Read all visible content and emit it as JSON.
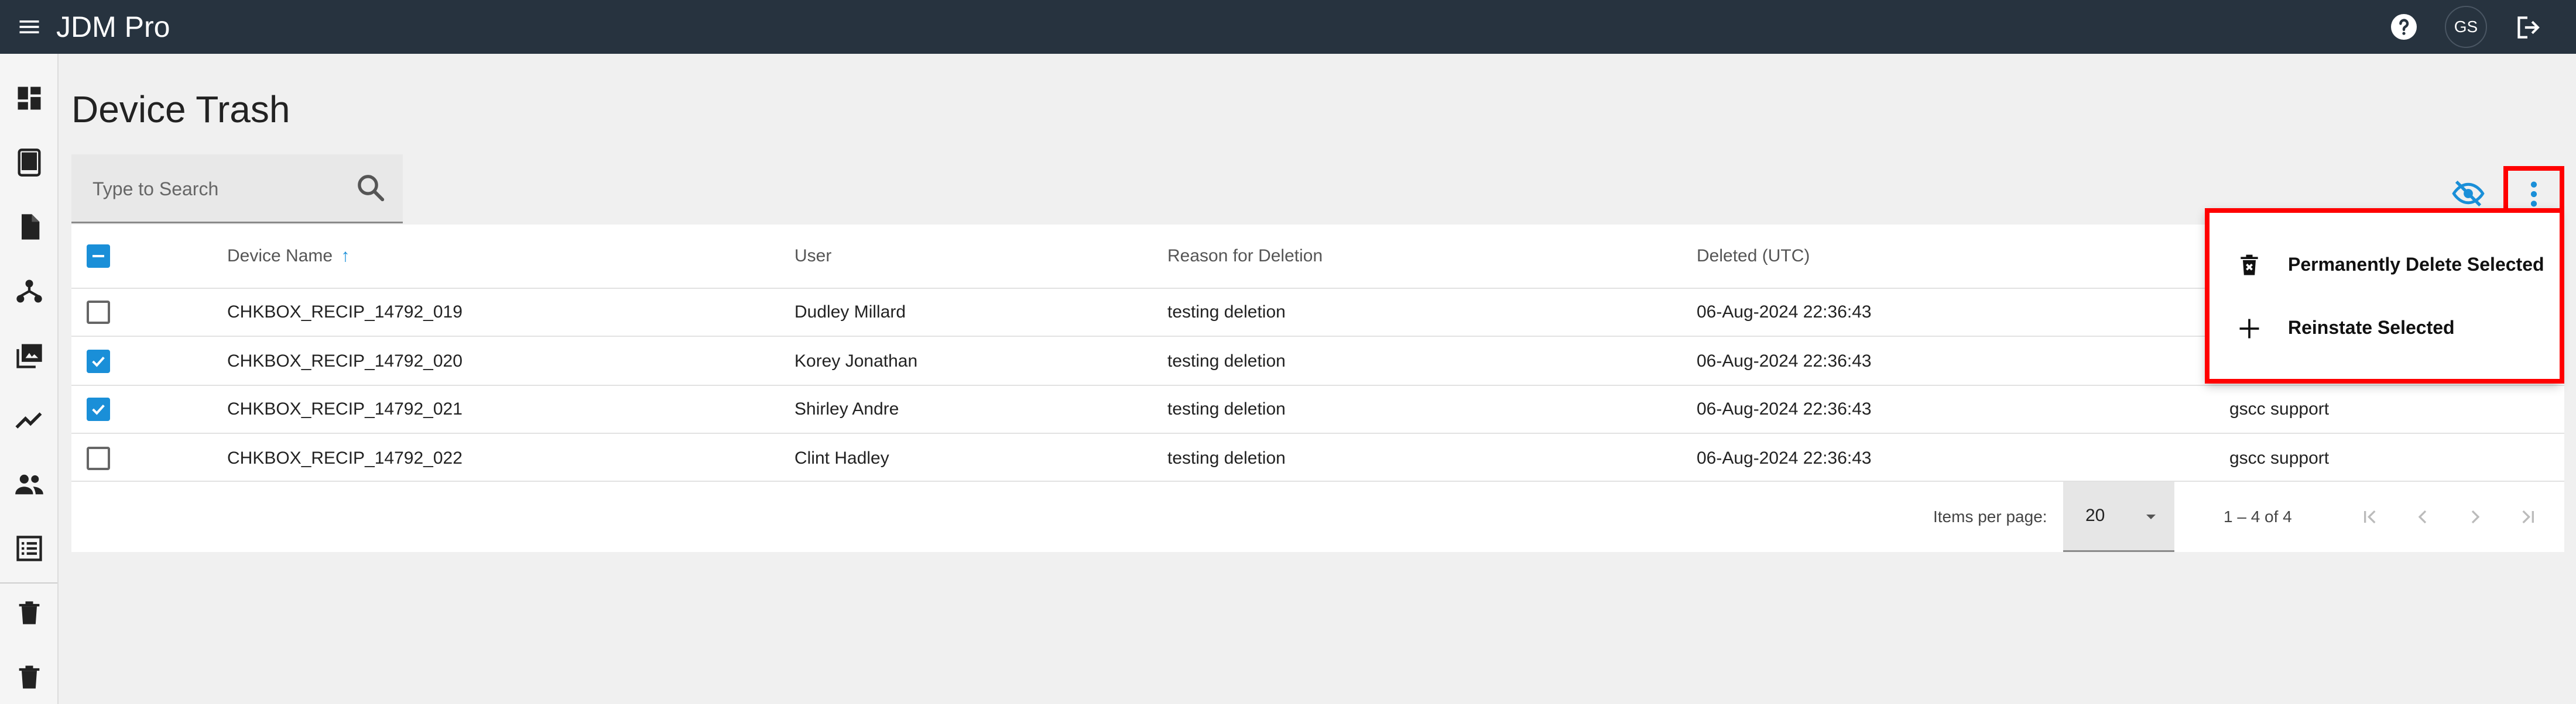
{
  "app": {
    "title": "JDM Pro",
    "user_initials": "GS"
  },
  "page": {
    "title": "Device Trash"
  },
  "search": {
    "placeholder": "Type to Search"
  },
  "table": {
    "columns": [
      "Device Name",
      "User",
      "Reason for Deletion",
      "Deleted (UTC)",
      ""
    ],
    "sort_indicator": "↑",
    "rows": [
      {
        "device": "CHKBOX_RECIP_14792_019",
        "user": "Dudley Millard",
        "reason": "testing deletion",
        "deleted": "06-Aug-2024 22:36:43",
        "deleted_by": "",
        "checked": false
      },
      {
        "device": "CHKBOX_RECIP_14792_020",
        "user": "Korey Jonathan",
        "reason": "testing deletion",
        "deleted": "06-Aug-2024 22:36:43",
        "deleted_by": "",
        "checked": true
      },
      {
        "device": "CHKBOX_RECIP_14792_021",
        "user": "Shirley Andre",
        "reason": "testing deletion",
        "deleted": "06-Aug-2024 22:36:43",
        "deleted_by": "gscc support",
        "checked": true
      },
      {
        "device": "CHKBOX_RECIP_14792_022",
        "user": "Clint Hadley",
        "reason": "testing deletion",
        "deleted": "06-Aug-2024 22:36:43",
        "deleted_by": "gscc support",
        "checked": false
      }
    ]
  },
  "paginator": {
    "items_per_page_label": "Items per page:",
    "page_size": "20",
    "range": "1 – 4 of 4"
  },
  "menu": {
    "items": [
      {
        "label": "Permanently Delete Selected",
        "icon": "delete-forever-icon"
      },
      {
        "label": "Reinstate Selected",
        "icon": "add-icon"
      }
    ]
  },
  "colors": {
    "topbar": "#27333f",
    "accent": "#1a8fd8",
    "highlight": "#ff0000"
  }
}
